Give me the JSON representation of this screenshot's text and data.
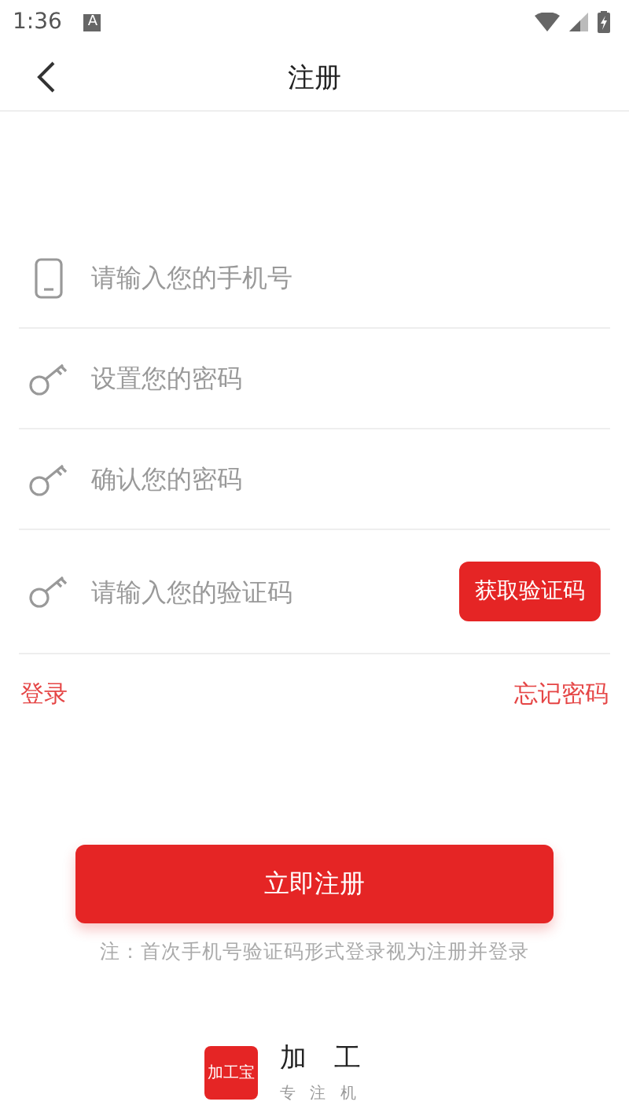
{
  "status_bar": {
    "time": "1:36",
    "notification": "A"
  },
  "header": {
    "title": "注册"
  },
  "fields": [
    {
      "kind": "phone",
      "placeholder": "请输入您的手机号"
    },
    {
      "kind": "key",
      "placeholder": "设置您的密码"
    },
    {
      "kind": "key",
      "placeholder": "确认您的密码"
    },
    {
      "kind": "key",
      "placeholder": "请输入您的验证码",
      "button": "获取验证码"
    }
  ],
  "links": {
    "login": "登录",
    "forgot": "忘记密码"
  },
  "submit": "立即注册",
  "note": "注：首次手机号验证码形式登录视为注册并登录",
  "brand": {
    "logo_text": "加工宝",
    "name": "加 工",
    "tagline": "专 注 机"
  }
}
